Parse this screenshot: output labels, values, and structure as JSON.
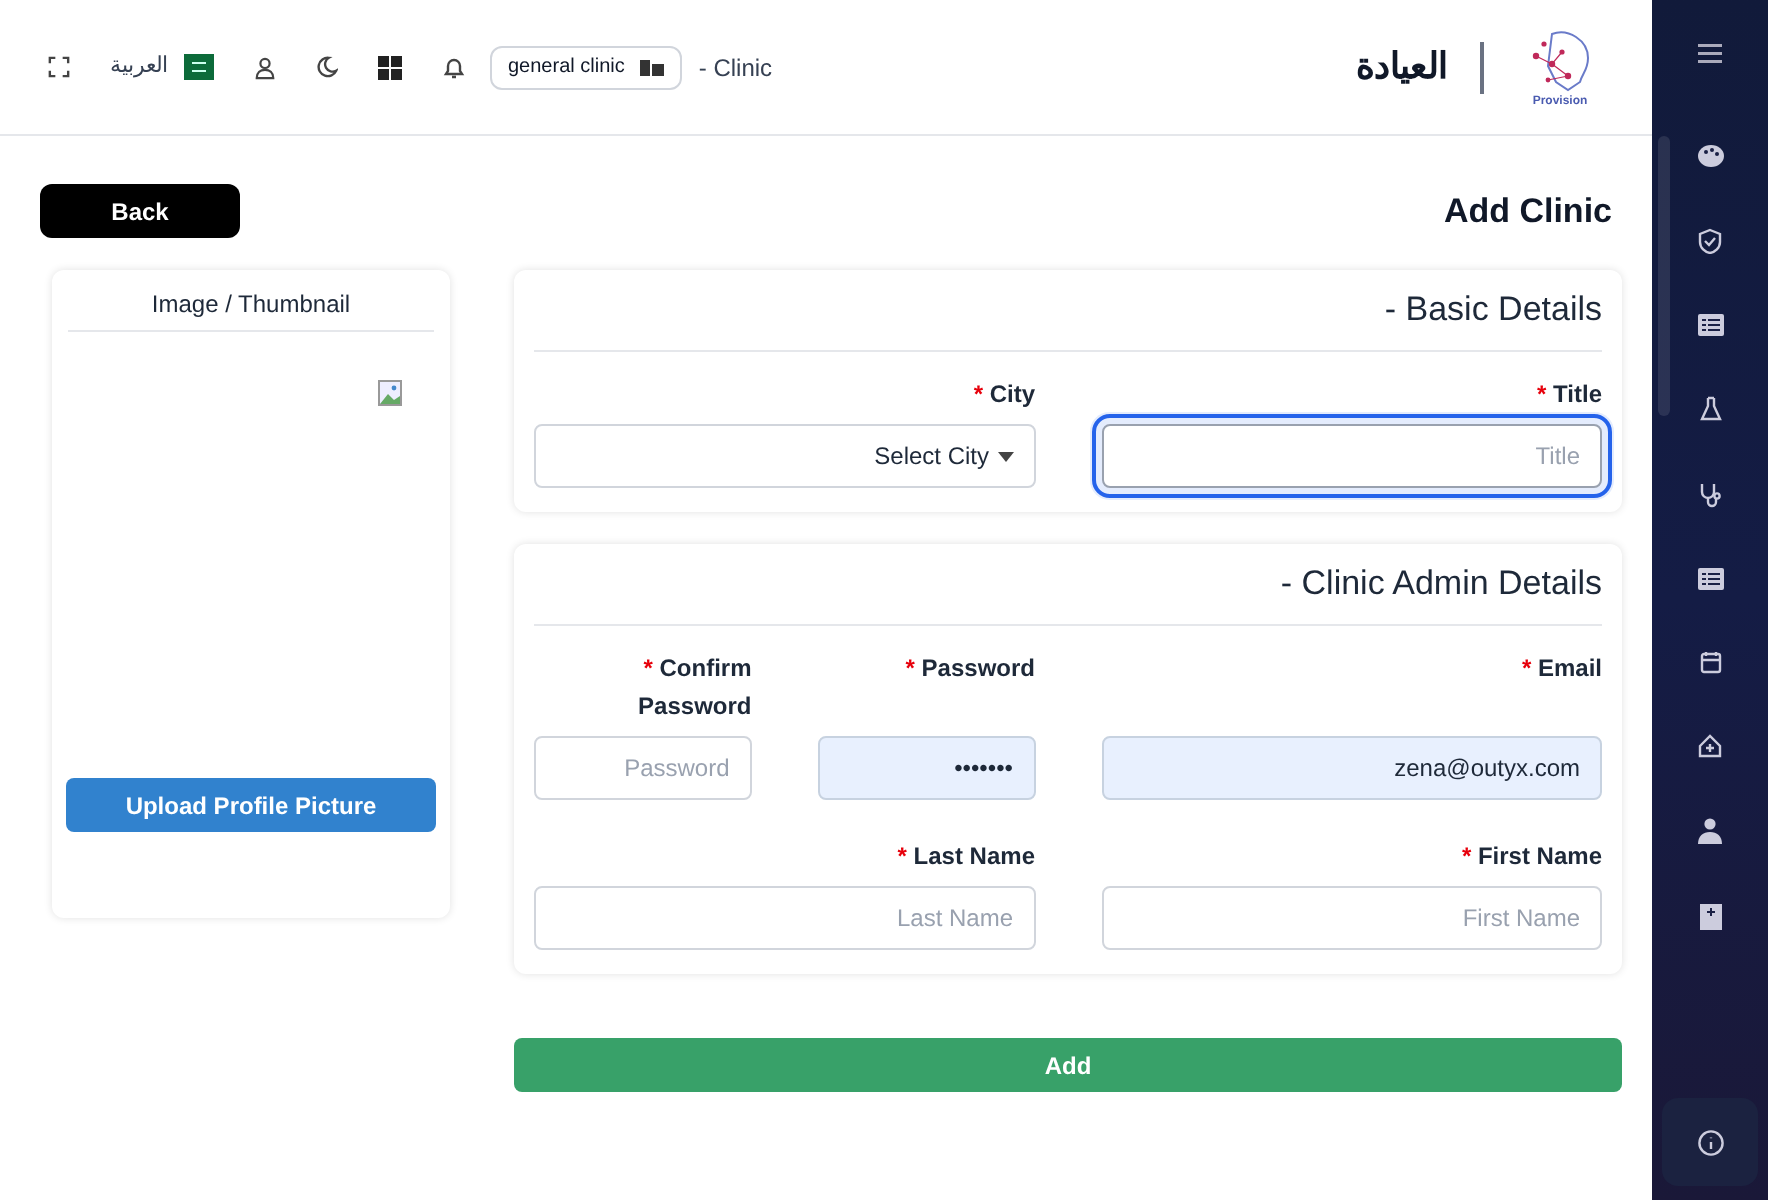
{
  "header": {
    "brand_name": "Provision",
    "clinic_name": "العيادة",
    "page_label": "- Clinic",
    "clinic_selector": "general clinic",
    "language": "العربية"
  },
  "back_button": "Back",
  "page_title": "Add Clinic",
  "image_card": {
    "title": "Image / Thumbnail",
    "upload_button": "Upload Profile Picture"
  },
  "sections": [
    {
      "title": "- Basic Details",
      "lines": [
        {
          "fields": [
            {
              "kind": "select",
              "label": "City",
              "required_mark": "*",
              "value": "Select City",
              "focused": false
            },
            {
              "kind": "text",
              "label": "Title",
              "required_mark": "*",
              "placeholder": "Title",
              "focused": true
            }
          ]
        }
      ]
    },
    {
      "title": "- Clinic Admin Details",
      "lines": [
        {
          "fields": [
            {
              "kind": "text",
              "label": "Confirm Password",
              "required_mark": "*",
              "placeholder": "Password",
              "focused": false
            },
            {
              "kind": "text",
              "label": "Password",
              "required_mark": "*",
              "value": "•••••••",
              "autofilled": true,
              "focused": false
            },
            {
              "kind": "text",
              "label": "Email",
              "required_mark": "*",
              "value": "zena@outyx.com",
              "autofilled": true,
              "focused": false
            }
          ]
        },
        {
          "fields": [
            {
              "kind": "text",
              "label": "Last Name",
              "required_mark": "*",
              "placeholder": "Last Name",
              "focused": false
            },
            {
              "kind": "text",
              "label": "First Name",
              "required_mark": "*",
              "placeholder": "First Name",
              "focused": false
            }
          ]
        }
      ]
    }
  ],
  "submit_button": "Add"
}
